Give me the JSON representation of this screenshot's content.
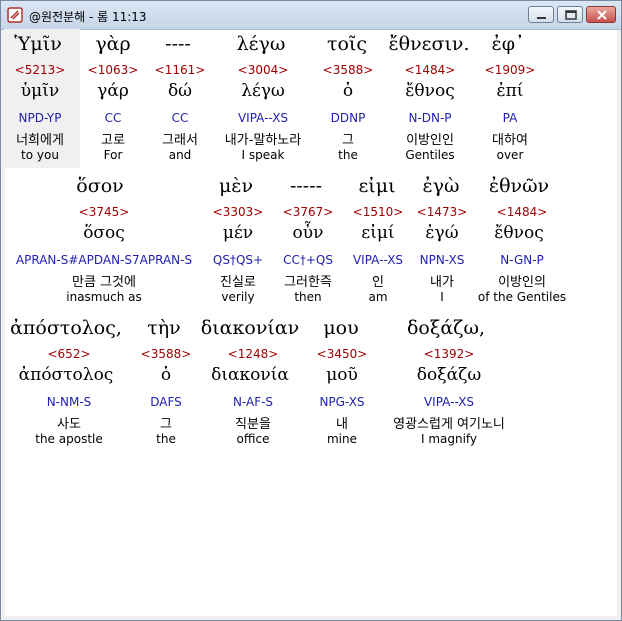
{
  "window": {
    "title": "@원전분해 - 롬 11:13"
  },
  "lines": [
    {
      "words": [
        {
          "greek": "Ὑμῖν",
          "strong": "<5213>",
          "lemma": "ὑμῖν",
          "parsing": "NPD-YP",
          "korean": "너희에게",
          "english": "to you"
        },
        {
          "greek": "γὰρ",
          "strong": "<1063>",
          "lemma": "γάρ",
          "parsing": "CC",
          "korean": "고로",
          "english": "For"
        },
        {
          "greek": "----",
          "strong": "<1161>",
          "lemma": "δώ",
          "parsing": "CC",
          "korean": "그래서",
          "english": "and"
        },
        {
          "greek": "λέγω",
          "strong": "<3004>",
          "lemma": "λέγω",
          "parsing": "VIPA--XS",
          "korean": "내가-말하노라",
          "english": "I speak"
        },
        {
          "greek": "τοῖς",
          "strong": "<3588>",
          "lemma": "ὁ",
          "parsing": "DDNP",
          "korean": "그",
          "english": "the"
        },
        {
          "greek": "ἔθνεσιν.",
          "strong": "<1484>",
          "lemma": "ἔθνος",
          "parsing": "N-DN-P",
          "korean": "이방인인",
          "english": "Gentiles"
        },
        {
          "greek": "ἐφ᾽",
          "strong": "<1909>",
          "lemma": "ἐπί",
          "parsing": "PA",
          "korean": "대하여",
          "english": "over"
        }
      ]
    },
    {
      "words": [
        {
          "greek": "ὅσον",
          "strong": "<3745>",
          "lemma": "ὅσος",
          "parsing": "APRAN-S#APDAN-S7APRAN-S",
          "korean": "만큼 그것에",
          "english": "inasmuch as"
        },
        {
          "greek": "μὲν",
          "strong": "<3303>",
          "lemma": "μέν",
          "parsing": "QS†QS+",
          "korean": "진실로",
          "english": "verily"
        },
        {
          "greek": "-----",
          "strong": "<3767>",
          "lemma": "οὖν",
          "parsing": "CC†+QS",
          "korean": "그러한즉",
          "english": "then"
        },
        {
          "greek": "εἰμι",
          "strong": "<1510>",
          "lemma": "εἰμί",
          "parsing": "VIPA--XS",
          "korean": "인",
          "english": "am"
        },
        {
          "greek": "ἐγὼ",
          "strong": "<1473>",
          "lemma": "ἐγώ",
          "parsing": "NPN-XS",
          "korean": "내가",
          "english": "I"
        },
        {
          "greek": "ἐθνῶν",
          "strong": "<1484>",
          "lemma": "ἔθνος",
          "parsing": "N-GN-P",
          "korean": "이방인의",
          "english": "of the Gentiles"
        }
      ]
    },
    {
      "words": [
        {
          "greek": "ἀπόστολος,",
          "strong": "<652>",
          "lemma": "ἀπόστολος",
          "parsing": "N-NM-S",
          "korean": "사도",
          "english": "the apostle"
        },
        {
          "greek": "τὴν",
          "strong": "<3588>",
          "lemma": "ὁ",
          "parsing": "DAFS",
          "korean": "그",
          "english": "the"
        },
        {
          "greek": "διακονίαν",
          "strong": "<1248>",
          "lemma": "διακονία",
          "parsing": "N-AF-S",
          "korean": "직분을",
          "english": "office"
        },
        {
          "greek": "μου",
          "strong": "<3450>",
          "lemma": "μοῦ",
          "parsing": "NPG-XS",
          "korean": "내",
          "english": "mine"
        },
        {
          "greek": "δοξάζω,",
          "strong": "<1392>",
          "lemma": "δοξάζω",
          "parsing": "VIPA--XS",
          "korean": "영광스럽게 여기노니",
          "english": "I magnify"
        }
      ]
    }
  ],
  "colors": {
    "strong": "#a00000",
    "parsing": "#1f1fb0",
    "selection_bg": "#f0f0f0"
  },
  "icons": [
    "app-icon",
    "minimize-icon",
    "maximize-icon",
    "close-icon"
  ]
}
